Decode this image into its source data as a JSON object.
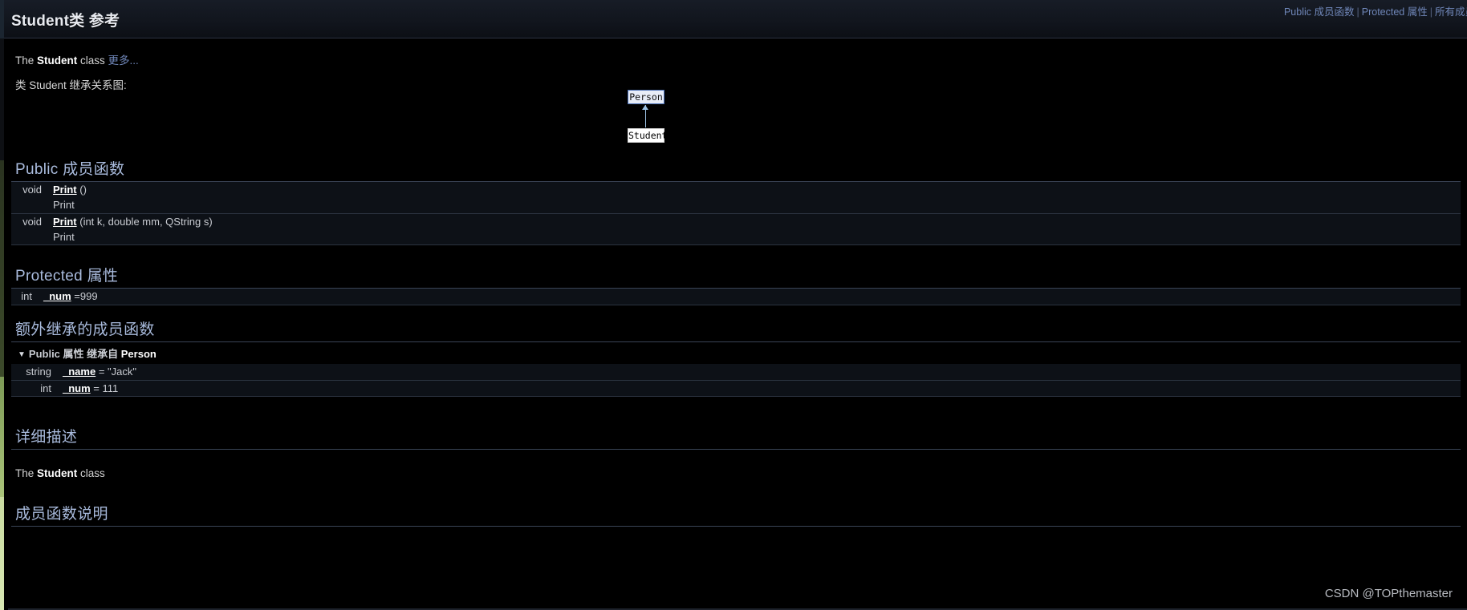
{
  "header": {
    "title": "Student类 参考",
    "summary_links": [
      {
        "label": "Public 成员函数"
      },
      {
        "label": "Protected 属性"
      },
      {
        "label": "所有成员"
      }
    ],
    "separator": "|"
  },
  "brief": {
    "prefix": "The ",
    "class_name": "Student",
    "suffix": " class ",
    "more_link": "更多..."
  },
  "inheritance": {
    "caption": "类 Student 继承关系图:",
    "base_node": "Person",
    "current_node": "Student"
  },
  "sections": {
    "public_functions": {
      "heading": "Public 成员函数",
      "rows": [
        {
          "type": "void",
          "name": "Print",
          "args": " ()",
          "description": "Print"
        },
        {
          "type": "void",
          "name": "Print",
          "args": " (int k, double mm, QString s)",
          "description": "Print"
        }
      ]
    },
    "protected_attributes": {
      "heading": "Protected 属性",
      "rows": [
        {
          "type": "int",
          "name": "_num",
          "value": " =999"
        }
      ]
    },
    "additional_inherited": {
      "heading": "额外继承的成员函数",
      "group_label_prefix": "Public 属性 继承自 ",
      "group_label_class": "Person",
      "triangle": "▼",
      "rows": [
        {
          "type": "string",
          "name": "_name",
          "value": " = \"Jack\""
        },
        {
          "type": "int",
          "name": "_num",
          "value": " = 111"
        }
      ]
    },
    "detailed_description": {
      "heading": "详细描述",
      "text_prefix": "The ",
      "text_class": "Student",
      "text_suffix": " class"
    },
    "member_function_doc": {
      "heading": "成员函数说明"
    }
  },
  "watermark": {
    "text": "CSDN @TOPthemaster"
  }
}
